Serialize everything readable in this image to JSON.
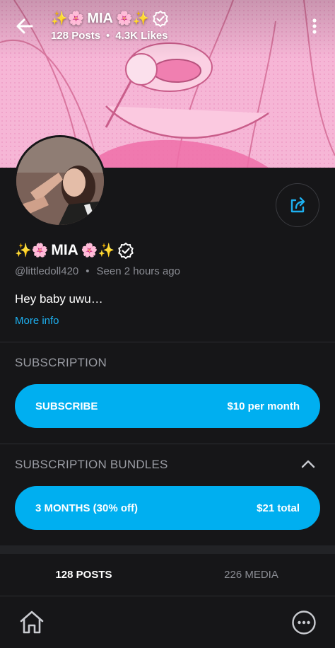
{
  "header": {
    "title_prefix": "✨🌸",
    "title_name": "MIA",
    "title_suffix": "🌸✨",
    "posts_stat": "128 Posts",
    "likes_stat": "4.3K Likes",
    "separator": "•",
    "back_icon": "back-arrow-icon",
    "menu_icon": "kebab-menu-icon",
    "verified_icon": "verified-badge-icon"
  },
  "profile": {
    "name_prefix": "✨🌸",
    "name": "MIA",
    "name_suffix": "🌸✨",
    "handle": "@littledoll420",
    "separator": "•",
    "last_seen": "Seen 2 hours ago",
    "bio": "Hey baby uwu…",
    "more_info": "More info",
    "share_icon": "share-icon"
  },
  "subscription": {
    "heading": "SUBSCRIPTION",
    "button_label": "SUBSCRIBE",
    "button_price": "$10 per month"
  },
  "bundles": {
    "heading": "SUBSCRIPTION BUNDLES",
    "collapse_icon": "chevron-up-icon",
    "items": [
      {
        "label": "3 MONTHS (30% off)",
        "price": "$21 total"
      }
    ]
  },
  "tabs": [
    {
      "label": "128 POSTS",
      "active": true
    },
    {
      "label": "226 MEDIA",
      "active": false
    }
  ],
  "bottom_nav": {
    "home_icon": "home-icon",
    "more_icon": "more-options-icon"
  },
  "colors": {
    "accent": "#00aff0",
    "link": "#1db0f0",
    "background": "#161618",
    "banner_pink": "#f3a9cf"
  }
}
